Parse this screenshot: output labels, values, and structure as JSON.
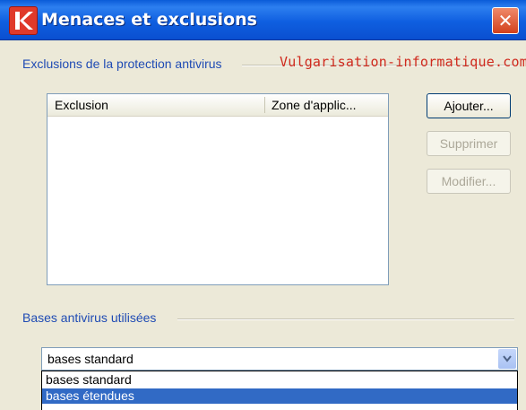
{
  "window": {
    "title": "Menaces et exclusions",
    "close_glyph": "✕"
  },
  "watermark": "Vulgarisation-informatique.com",
  "exclusions_group": {
    "label": "Exclusions de la protection antivirus",
    "columns": [
      "Exclusion",
      "Zone d'applic..."
    ],
    "buttons": {
      "add": "Ajouter...",
      "delete": "Supprimer",
      "modify": "Modifier..."
    }
  },
  "bases_group": {
    "label": "Bases antivirus utilisées",
    "combo_value": "bases standard",
    "options": [
      "bases standard",
      "bases étendues"
    ],
    "selected_index": 1
  },
  "colors": {
    "titlebar": "#0a5bd8",
    "group_label": "#1f4bb4",
    "watermark": "#d02a1e",
    "selection": "#316ac5"
  },
  "icons": {
    "app": "kaspersky-k-icon",
    "close": "close-icon",
    "combo_arrow": "chevron-down-icon"
  }
}
